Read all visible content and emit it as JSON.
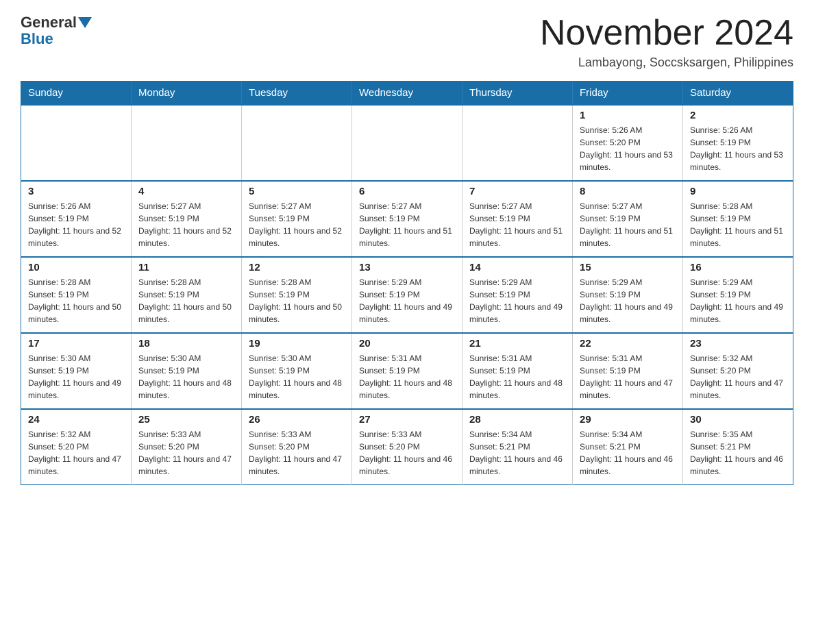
{
  "logo": {
    "general": "General",
    "blue": "Blue"
  },
  "title": {
    "month_year": "November 2024",
    "location": "Lambayong, Soccsksargen, Philippines"
  },
  "weekdays": [
    "Sunday",
    "Monday",
    "Tuesday",
    "Wednesday",
    "Thursday",
    "Friday",
    "Saturday"
  ],
  "weeks": [
    [
      {
        "day": "",
        "sunrise": "",
        "sunset": "",
        "daylight": ""
      },
      {
        "day": "",
        "sunrise": "",
        "sunset": "",
        "daylight": ""
      },
      {
        "day": "",
        "sunrise": "",
        "sunset": "",
        "daylight": ""
      },
      {
        "day": "",
        "sunrise": "",
        "sunset": "",
        "daylight": ""
      },
      {
        "day": "",
        "sunrise": "",
        "sunset": "",
        "daylight": ""
      },
      {
        "day": "1",
        "sunrise": "Sunrise: 5:26 AM",
        "sunset": "Sunset: 5:20 PM",
        "daylight": "Daylight: 11 hours and 53 minutes."
      },
      {
        "day": "2",
        "sunrise": "Sunrise: 5:26 AM",
        "sunset": "Sunset: 5:19 PM",
        "daylight": "Daylight: 11 hours and 53 minutes."
      }
    ],
    [
      {
        "day": "3",
        "sunrise": "Sunrise: 5:26 AM",
        "sunset": "Sunset: 5:19 PM",
        "daylight": "Daylight: 11 hours and 52 minutes."
      },
      {
        "day": "4",
        "sunrise": "Sunrise: 5:27 AM",
        "sunset": "Sunset: 5:19 PM",
        "daylight": "Daylight: 11 hours and 52 minutes."
      },
      {
        "day": "5",
        "sunrise": "Sunrise: 5:27 AM",
        "sunset": "Sunset: 5:19 PM",
        "daylight": "Daylight: 11 hours and 52 minutes."
      },
      {
        "day": "6",
        "sunrise": "Sunrise: 5:27 AM",
        "sunset": "Sunset: 5:19 PM",
        "daylight": "Daylight: 11 hours and 51 minutes."
      },
      {
        "day": "7",
        "sunrise": "Sunrise: 5:27 AM",
        "sunset": "Sunset: 5:19 PM",
        "daylight": "Daylight: 11 hours and 51 minutes."
      },
      {
        "day": "8",
        "sunrise": "Sunrise: 5:27 AM",
        "sunset": "Sunset: 5:19 PM",
        "daylight": "Daylight: 11 hours and 51 minutes."
      },
      {
        "day": "9",
        "sunrise": "Sunrise: 5:28 AM",
        "sunset": "Sunset: 5:19 PM",
        "daylight": "Daylight: 11 hours and 51 minutes."
      }
    ],
    [
      {
        "day": "10",
        "sunrise": "Sunrise: 5:28 AM",
        "sunset": "Sunset: 5:19 PM",
        "daylight": "Daylight: 11 hours and 50 minutes."
      },
      {
        "day": "11",
        "sunrise": "Sunrise: 5:28 AM",
        "sunset": "Sunset: 5:19 PM",
        "daylight": "Daylight: 11 hours and 50 minutes."
      },
      {
        "day": "12",
        "sunrise": "Sunrise: 5:28 AM",
        "sunset": "Sunset: 5:19 PM",
        "daylight": "Daylight: 11 hours and 50 minutes."
      },
      {
        "day": "13",
        "sunrise": "Sunrise: 5:29 AM",
        "sunset": "Sunset: 5:19 PM",
        "daylight": "Daylight: 11 hours and 49 minutes."
      },
      {
        "day": "14",
        "sunrise": "Sunrise: 5:29 AM",
        "sunset": "Sunset: 5:19 PM",
        "daylight": "Daylight: 11 hours and 49 minutes."
      },
      {
        "day": "15",
        "sunrise": "Sunrise: 5:29 AM",
        "sunset": "Sunset: 5:19 PM",
        "daylight": "Daylight: 11 hours and 49 minutes."
      },
      {
        "day": "16",
        "sunrise": "Sunrise: 5:29 AM",
        "sunset": "Sunset: 5:19 PM",
        "daylight": "Daylight: 11 hours and 49 minutes."
      }
    ],
    [
      {
        "day": "17",
        "sunrise": "Sunrise: 5:30 AM",
        "sunset": "Sunset: 5:19 PM",
        "daylight": "Daylight: 11 hours and 49 minutes."
      },
      {
        "day": "18",
        "sunrise": "Sunrise: 5:30 AM",
        "sunset": "Sunset: 5:19 PM",
        "daylight": "Daylight: 11 hours and 48 minutes."
      },
      {
        "day": "19",
        "sunrise": "Sunrise: 5:30 AM",
        "sunset": "Sunset: 5:19 PM",
        "daylight": "Daylight: 11 hours and 48 minutes."
      },
      {
        "day": "20",
        "sunrise": "Sunrise: 5:31 AM",
        "sunset": "Sunset: 5:19 PM",
        "daylight": "Daylight: 11 hours and 48 minutes."
      },
      {
        "day": "21",
        "sunrise": "Sunrise: 5:31 AM",
        "sunset": "Sunset: 5:19 PM",
        "daylight": "Daylight: 11 hours and 48 minutes."
      },
      {
        "day": "22",
        "sunrise": "Sunrise: 5:31 AM",
        "sunset": "Sunset: 5:19 PM",
        "daylight": "Daylight: 11 hours and 47 minutes."
      },
      {
        "day": "23",
        "sunrise": "Sunrise: 5:32 AM",
        "sunset": "Sunset: 5:20 PM",
        "daylight": "Daylight: 11 hours and 47 minutes."
      }
    ],
    [
      {
        "day": "24",
        "sunrise": "Sunrise: 5:32 AM",
        "sunset": "Sunset: 5:20 PM",
        "daylight": "Daylight: 11 hours and 47 minutes."
      },
      {
        "day": "25",
        "sunrise": "Sunrise: 5:33 AM",
        "sunset": "Sunset: 5:20 PM",
        "daylight": "Daylight: 11 hours and 47 minutes."
      },
      {
        "day": "26",
        "sunrise": "Sunrise: 5:33 AM",
        "sunset": "Sunset: 5:20 PM",
        "daylight": "Daylight: 11 hours and 47 minutes."
      },
      {
        "day": "27",
        "sunrise": "Sunrise: 5:33 AM",
        "sunset": "Sunset: 5:20 PM",
        "daylight": "Daylight: 11 hours and 46 minutes."
      },
      {
        "day": "28",
        "sunrise": "Sunrise: 5:34 AM",
        "sunset": "Sunset: 5:21 PM",
        "daylight": "Daylight: 11 hours and 46 minutes."
      },
      {
        "day": "29",
        "sunrise": "Sunrise: 5:34 AM",
        "sunset": "Sunset: 5:21 PM",
        "daylight": "Daylight: 11 hours and 46 minutes."
      },
      {
        "day": "30",
        "sunrise": "Sunrise: 5:35 AM",
        "sunset": "Sunset: 5:21 PM",
        "daylight": "Daylight: 11 hours and 46 minutes."
      }
    ]
  ]
}
